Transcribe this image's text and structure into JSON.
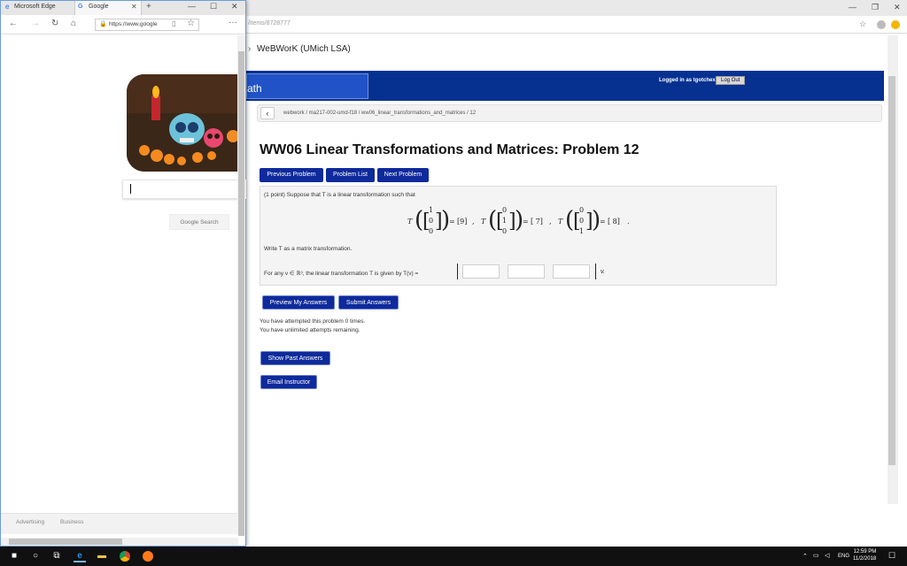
{
  "back_window": {
    "url_fragment": "/items/8728777",
    "page_title": "WeBWorK (UMich LSA)",
    "banner_logo_fragment": "ath",
    "logged_in": "Logged in as tgotchex",
    "logout_label": "Log Out",
    "breadcrumb": "webwork / ma217-002-umd-f18 / ww06_linear_transformations_and_matrices / 12",
    "problem_title": "WW06 Linear Transformations and Matrices: Problem 12",
    "nav_buttons": [
      "Previous Problem",
      "Problem List",
      "Next Problem"
    ],
    "problem": {
      "intro": "(1 point) Suppose that T is a linear transformation such that",
      "images": [
        "[9]",
        "[ 7]",
        "[ 8]"
      ],
      "write_text": "Write T as a matrix transformation.",
      "for_any_text": "For any v ∈ ℝ³, the linear transformation T is given by T(v) =",
      "vector": "v."
    },
    "actions": [
      "Preview My Answers",
      "Submit Answers"
    ],
    "attempts_line1": "You have attempted this problem 0 times.",
    "attempts_line2": "You have unlimited attempts remaining.",
    "show_past": "Show Past Answers",
    "email": "Email Instructor"
  },
  "front_window": {
    "tabs": [
      "Microsoft Edge",
      "Google"
    ],
    "url": "https://www.google",
    "search_button": "Google Search",
    "footer_links": [
      "Advertising",
      "Business"
    ]
  },
  "taskbar": {
    "lang": "ENG",
    "time": "12:59 PM",
    "date": "11/2/2018"
  }
}
